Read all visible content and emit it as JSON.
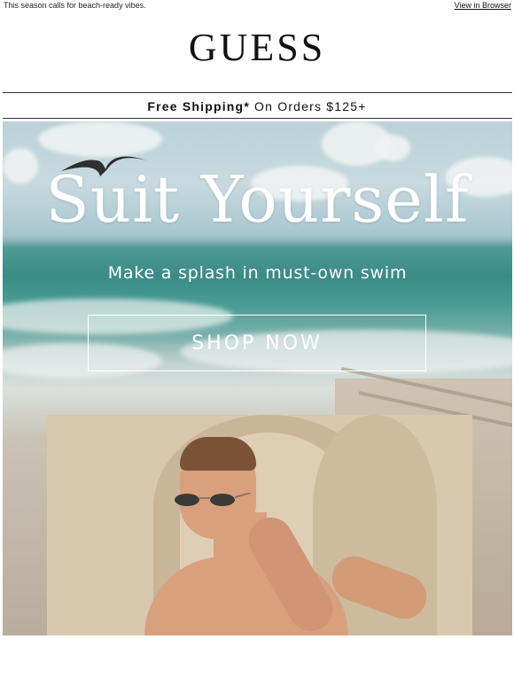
{
  "preheader": "This season calls for beach-ready vibes.",
  "view_in_browser": "View in Browser",
  "brand": "GUESS",
  "shipping": {
    "bold": "Free Shipping*",
    "rest": " On Orders $125+"
  },
  "hero": {
    "headline": "Suit Yourself",
    "subline": "Make a splash in must-own swim",
    "cta": "SHOP NOW"
  },
  "colors": {
    "text": "#111111",
    "hero_text": "#ffffff",
    "sea": "#3a8b86"
  }
}
